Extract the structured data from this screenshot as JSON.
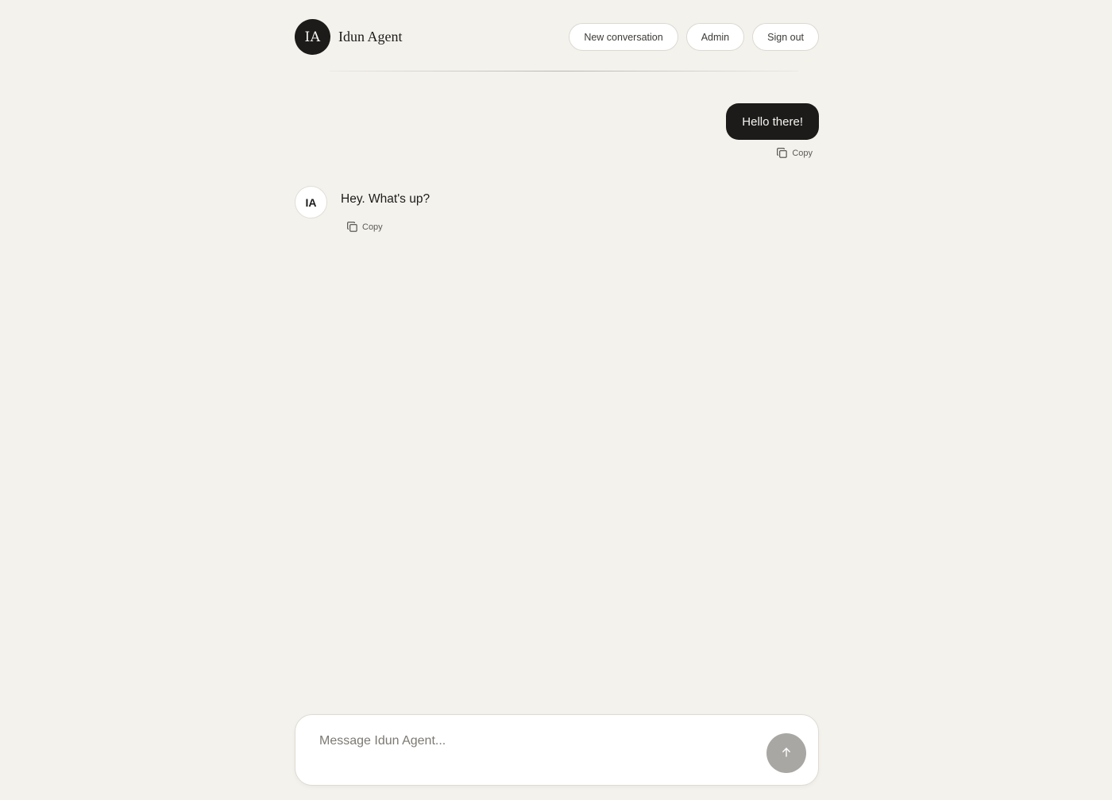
{
  "brand": {
    "logo_text": "IA",
    "name": "Idun Agent"
  },
  "nav": {
    "new_conversation": "New conversation",
    "admin": "Admin",
    "sign_out": "Sign out"
  },
  "messages": [
    {
      "role": "user",
      "text": "Hello there!",
      "copy_label": "Copy"
    },
    {
      "role": "agent",
      "avatar": "IA",
      "text": "Hey. What's up?",
      "copy_label": "Copy"
    }
  ],
  "composer": {
    "placeholder": "Message Idun Agent...",
    "value": "",
    "send_icon": "arrow-up-icon"
  },
  "icons": {
    "copy": "copy-icon",
    "send": "arrow-up-icon"
  },
  "colors": {
    "background": "#f4f2ec",
    "accent": "#1c1b1a",
    "send_disabled": "#a9a7a3"
  }
}
